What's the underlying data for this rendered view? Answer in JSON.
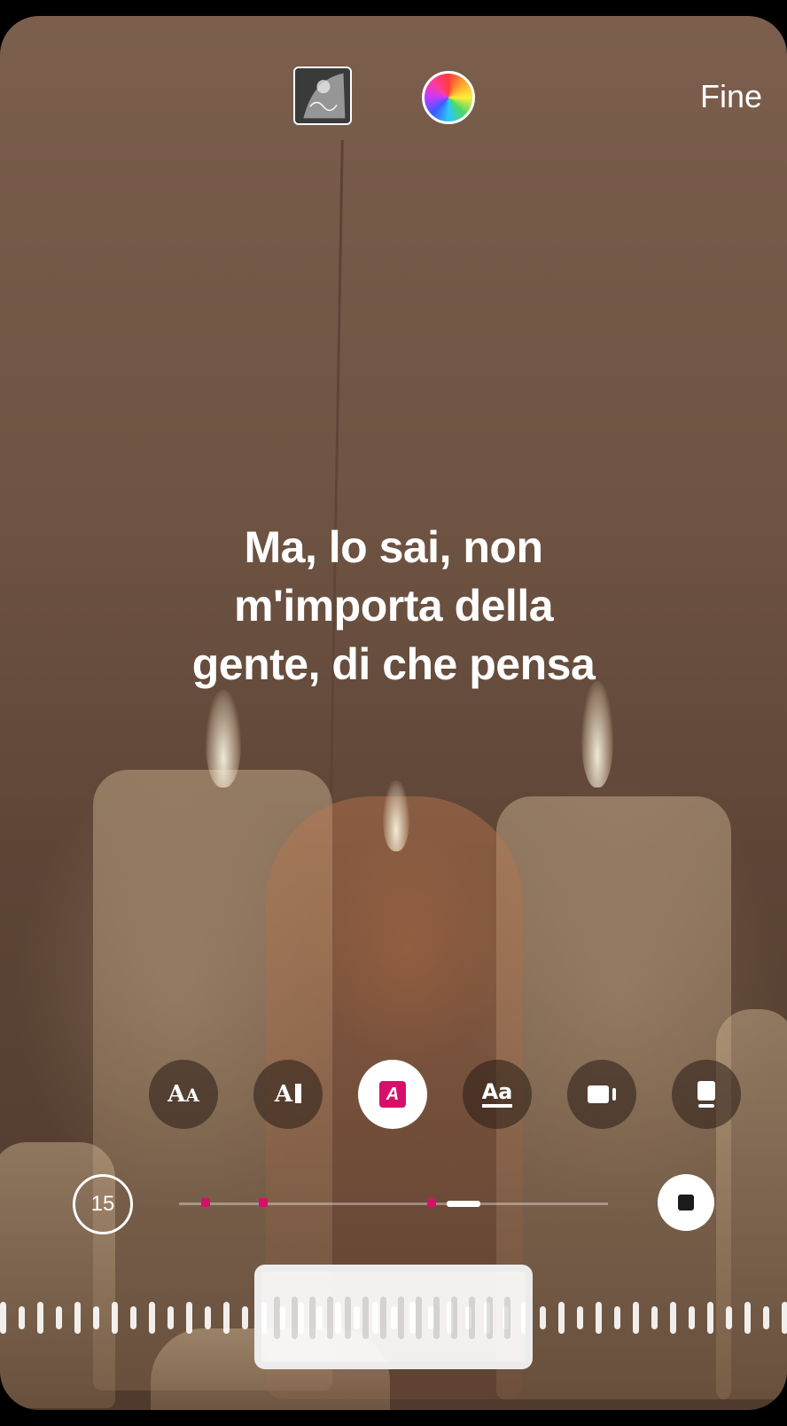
{
  "header": {
    "done_label": "Fine",
    "album_icon": "album-cover-thumbnail",
    "color_icon": "color-wheel-icon"
  },
  "lyrics": {
    "lines": [
      "Ma, lo sai, non",
      "m'importa della",
      "gente, di che pensa"
    ]
  },
  "style_options": [
    {
      "name": "typewriter-style",
      "glyph": "AA",
      "active": false
    },
    {
      "name": "cursor-style",
      "glyph": "A|",
      "active": false
    },
    {
      "name": "highlight-style",
      "glyph": "A",
      "active": true
    },
    {
      "name": "underline-style",
      "glyph": "Aa",
      "active": false
    },
    {
      "name": "video-card-style",
      "glyph": "card",
      "active": false
    },
    {
      "name": "sticker-card-style",
      "glyph": "card2",
      "active": false
    }
  ],
  "playback": {
    "duration_label": "15",
    "progress_fraction": 0.7,
    "accent_color": "#d6106a"
  }
}
